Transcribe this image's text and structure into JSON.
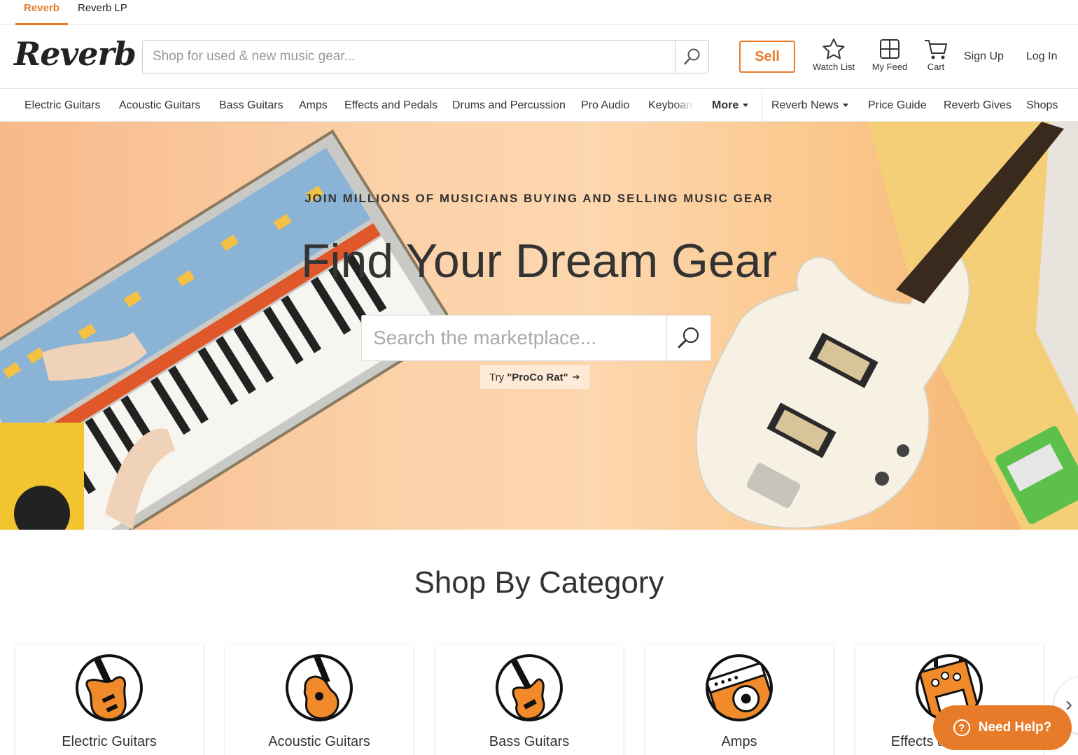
{
  "brand_tabs": [
    {
      "label": "Reverb",
      "active": true
    },
    {
      "label": "Reverb LP",
      "active": false
    }
  ],
  "header": {
    "logo_text": "Reverb",
    "search_placeholder": "Shop for used & new music gear...",
    "search_icon": "search-icon",
    "sell_label": "Sell",
    "watch_list_label": "Watch List",
    "my_feed_label": "My Feed",
    "cart_label": "Cart",
    "sign_up_label": "Sign Up",
    "log_in_label": "Log In"
  },
  "category_nav": {
    "items": [
      "Electric Guitars",
      "Acoustic Guitars",
      "Bass Guitars",
      "Amps",
      "Effects and Pedals",
      "Drums and Percussion",
      "Pro Audio",
      "Keyboards"
    ],
    "more_label": "More",
    "reverb_news_label": "Reverb News",
    "price_guide_label": "Price Guide",
    "reverb_gives_label": "Reverb Gives",
    "shops_label": "Shops"
  },
  "hero": {
    "eyebrow": "JOIN MILLIONS OF MUSICIANS BUYING AND SELLING MUSIC GEAR",
    "title": "Find Your Dream Gear",
    "search_placeholder": "Search the marketplace...",
    "try_prefix": "Try",
    "try_suggestion": "\"ProCo Rat\"",
    "try_arrow": "➔"
  },
  "shop_by_category": {
    "title": "Shop By Category",
    "cards": [
      {
        "label": "Electric Guitars",
        "icon": "electric-guitar-icon"
      },
      {
        "label": "Acoustic Guitars",
        "icon": "acoustic-guitar-icon"
      },
      {
        "label": "Bass Guitars",
        "icon": "bass-guitar-icon"
      },
      {
        "label": "Amps",
        "icon": "amp-icon"
      },
      {
        "label": "Effects and Pedals",
        "icon": "pedal-icon"
      }
    ]
  },
  "help_button": {
    "label": "Need Help?",
    "q": "?"
  },
  "colors": {
    "accent": "#e87b2a"
  }
}
